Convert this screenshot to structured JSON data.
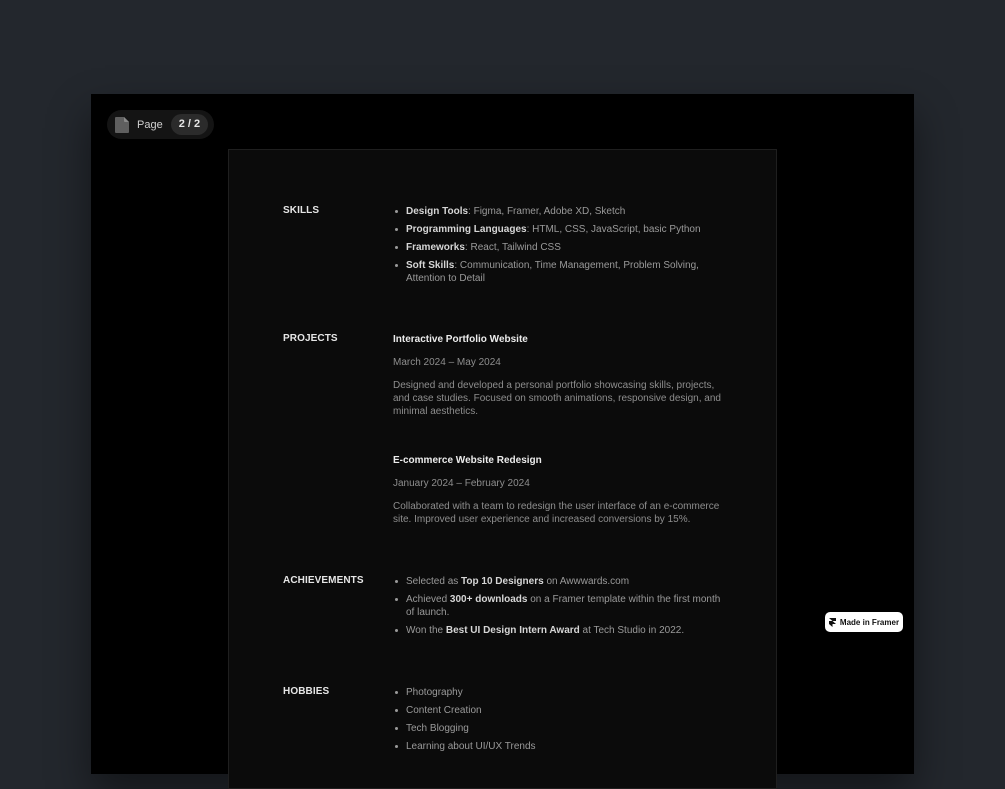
{
  "viewer": {
    "page_label": "Page",
    "page_count": "2 / 2"
  },
  "resume": {
    "skills": {
      "title": "SKILLS",
      "items": [
        {
          "label": "Design Tools",
          "text": ": Figma, Framer, Adobe XD, Sketch"
        },
        {
          "label": "Programming Languages",
          "text": ": HTML, CSS, JavaScript, basic Python"
        },
        {
          "label": "Frameworks",
          "text": ": React, Tailwind CSS"
        },
        {
          "label": "Soft Skills",
          "text": ": Communication, Time Management, Problem Solving, Attention to Detail"
        }
      ]
    },
    "projects": {
      "title": "PROJECTS",
      "items": [
        {
          "name": "Interactive Portfolio Website",
          "date": "March 2024 – May 2024",
          "description": "Designed and developed a personal portfolio showcasing skills, projects, and case studies. Focused on smooth animations, responsive design, and minimal aesthetics."
        },
        {
          "name": "E-commerce Website Redesign",
          "date": "January 2024 – February 2024",
          "description": "Collaborated with a team to redesign the user interface of an e-commerce site. Improved user experience and increased conversions by 15%."
        }
      ]
    },
    "achievements": {
      "title": "ACHIEVEMENTS",
      "items": [
        {
          "before": "Selected as ",
          "bold": "Top 10 Designers",
          "after": " on Awwwards.com"
        },
        {
          "before": "Achieved ",
          "bold": "300+ downloads",
          "after": " on a Framer template within the first month of launch."
        },
        {
          "before": "Won the ",
          "bold": "Best UI Design Intern Award",
          "after": " at Tech Studio in 2022."
        }
      ]
    },
    "hobbies": {
      "title": "HOBBIES",
      "items": [
        "Photography",
        "Content Creation",
        "Tech Blogging",
        "Learning about UI/UX Trends"
      ]
    }
  },
  "badge": {
    "label": "Made in Framer",
    "icon": "framer-logo-icon"
  }
}
